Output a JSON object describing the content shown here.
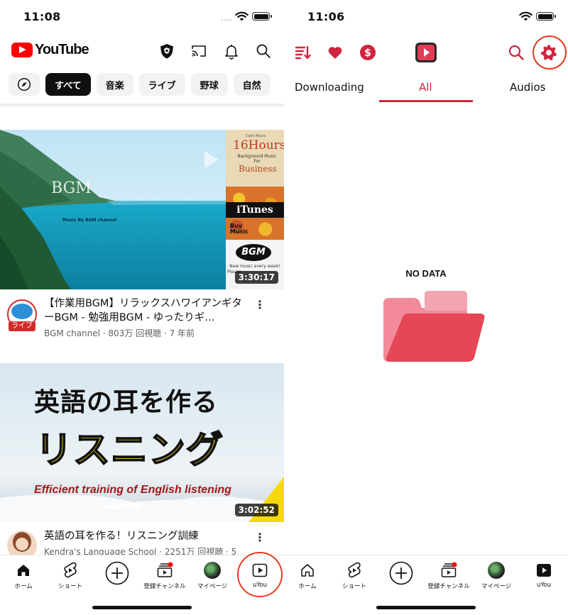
{
  "left_screen": {
    "status_bar": {
      "time": "11:08"
    },
    "header": {
      "logo_text": "YouTube",
      "brand_color": "#ff0000"
    },
    "chips": [
      {
        "label": "すべて",
        "active": true
      },
      {
        "label": "音楽"
      },
      {
        "label": "ライブ"
      },
      {
        "label": "野球"
      },
      {
        "label": "自然"
      }
    ],
    "videos": [
      {
        "title": "【作業用BGM】リラックスハワイアンギターBGM - 勉強用BGM - ゆったりギ…",
        "meta": "BGM channel · 803万 回視聴 · 7 年前",
        "duration": "3:30:17",
        "badge": "ライブ",
        "thumb_text": {
          "main": "BGM",
          "credit": "Music By BGM channel",
          "side_small": "Calm Music",
          "side_hours": "16Hours",
          "side_sub": "Background Music For",
          "side_business": "Business",
          "itunes": "iTunes",
          "buy": "Buy Music",
          "bgm_logo": "BGM",
          "new_music": "New music every week!",
          "please": "Please"
        }
      },
      {
        "title": "英語の耳を作る！リスニング訓練",
        "meta": "Kendra's Language School · 2251万 回視聴 · 5",
        "duration": "3:02:52",
        "thumb_text": {
          "line1": "英語の耳を作る",
          "line2": "リスニング",
          "line3": "Efficient training of English listening"
        }
      }
    ],
    "bottom_nav": [
      {
        "label": "ホーム",
        "icon": "home-filled-icon"
      },
      {
        "label": "ショート",
        "icon": "shorts-icon"
      },
      {
        "label": "",
        "icon": "create-plus-icon"
      },
      {
        "label": "登録チャンネル",
        "icon": "subscriptions-icon"
      },
      {
        "label": "マイページ",
        "icon": "profile-avatar"
      },
      {
        "label": "uYou",
        "icon": "uyou-icon"
      }
    ]
  },
  "right_screen": {
    "status_bar": {
      "time": "11:06"
    },
    "tabs": [
      {
        "label": "Downloading"
      },
      {
        "label": "All",
        "active": true
      },
      {
        "label": "Audios"
      }
    ],
    "empty_state": {
      "text": "NO DATA"
    },
    "accent_color": "#d0243e",
    "bottom_nav": [
      {
        "label": "ホーム",
        "icon": "home-outline-icon"
      },
      {
        "label": "ショート",
        "icon": "shorts-icon"
      },
      {
        "label": "",
        "icon": "create-plus-icon"
      },
      {
        "label": "登録チャンネル",
        "icon": "subscriptions-icon"
      },
      {
        "label": "マイページ",
        "icon": "profile-avatar"
      },
      {
        "label": "uYou",
        "icon": "uyou-icon"
      }
    ]
  }
}
